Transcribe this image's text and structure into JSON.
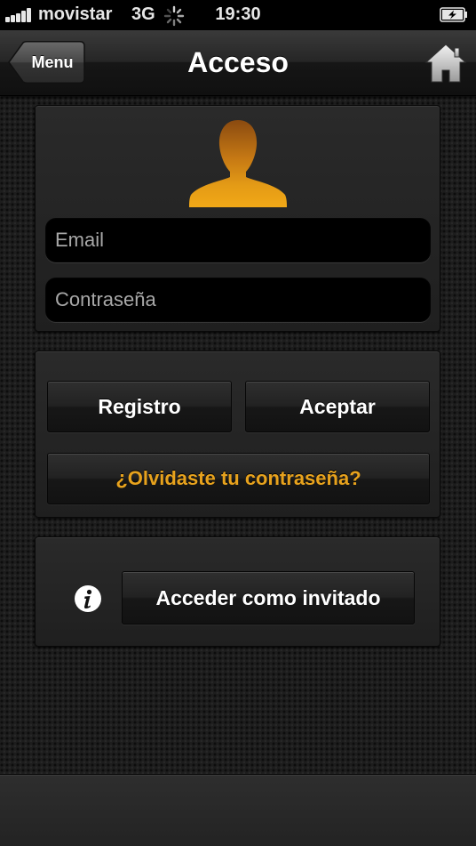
{
  "status_bar": {
    "carrier": "movistar",
    "network": "3G",
    "time": "19:30",
    "signal_icon": "signal-bars-icon",
    "activity_icon": "spinner-icon",
    "battery_icon": "battery-charging-icon"
  },
  "nav": {
    "back_label": "Menu",
    "title": "Acceso",
    "home_icon": "home-icon"
  },
  "login": {
    "avatar_icon": "user-silhouette-icon",
    "email_placeholder": "Email",
    "email_value": "",
    "password_placeholder": "Contraseña",
    "password_value": ""
  },
  "actions": {
    "register_label": "Registro",
    "accept_label": "Aceptar",
    "forgot_label": "¿Olvidaste tu contraseña?"
  },
  "guest": {
    "info_icon": "info-icon",
    "guest_label": "Acceder como invitado"
  },
  "colors": {
    "accent": "#e7a21d",
    "background": "#1d1d1d"
  }
}
